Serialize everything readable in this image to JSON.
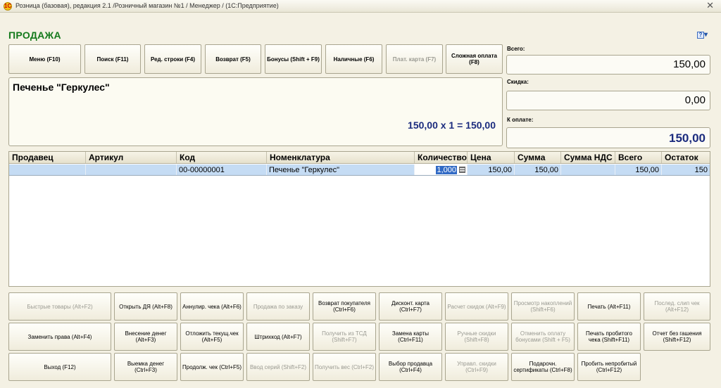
{
  "titlebar": {
    "title": "Розница (базовая), редакция 2.1 /Розничный магазин №1 / Менеджер /  (1С:Предприятие)",
    "app_icon": "1C",
    "close_glyph": "✕"
  },
  "page_title": "ПРОДАЖА",
  "help_glyph": "?",
  "toolbar": [
    {
      "label": "Меню (F10)",
      "disabled": false
    },
    {
      "label": "Поиск (F11)",
      "disabled": false
    },
    {
      "label": "Ред. строки (F4)",
      "disabled": false
    },
    {
      "label": "Возврат (F5)",
      "disabled": false
    },
    {
      "label": "Бонусы (Shift + F9)",
      "disabled": false
    },
    {
      "label": "Наличные (F6)",
      "disabled": false
    },
    {
      "label": "Плат. карта (F7)",
      "disabled": true
    },
    {
      "label": "Сложная оплата (F8)",
      "disabled": false
    }
  ],
  "totals": {
    "total_label": "Всего:",
    "total_value": "150,00",
    "discount_label": "Скидка:",
    "discount_value": "0,00",
    "topay_label": "К оплате:",
    "topay_value": "150,00"
  },
  "product": {
    "name": "Печенье \"Геркулес\"",
    "calc": "150,00  x 1  = 150,00"
  },
  "table": {
    "columns": [
      "Продавец",
      "Артикул",
      "Код",
      "Номенклатура",
      "Количество",
      "Цена",
      "Сумма",
      "Сумма НДС",
      "Всего",
      "Остаток"
    ],
    "rows": [
      {
        "seller": "",
        "article": "",
        "code": "00-00000001",
        "item": "Печенье \"Геркулес\"",
        "qty": "1,000",
        "price": "150,00",
        "sum": "150,00",
        "vat": "",
        "total": "150,00",
        "stock": "150"
      }
    ]
  },
  "bottom": [
    [
      {
        "label": "Быстрые товары (Alt+F2)",
        "disabled": true
      },
      {
        "label": "Открыть ДЯ (Alt+F8)",
        "disabled": false
      },
      {
        "label": "Аннулир. чека (Alt+F6)",
        "disabled": false
      },
      {
        "label": "Продажа по заказу",
        "disabled": true
      },
      {
        "label": "Возврат покупателя (Ctrl+F6)",
        "disabled": false
      },
      {
        "label": "Дисконт. карта (Ctrl+F7)",
        "disabled": false
      },
      {
        "label": "Расчет скидок (Alt+F9)",
        "disabled": true
      },
      {
        "label": "Просмотр накоплений (Shift+F6)",
        "disabled": true
      },
      {
        "label": "Печать (Alt+F11)",
        "disabled": false
      },
      {
        "label": "Послед. слип чек (Alt+F12)",
        "disabled": true
      }
    ],
    [
      {
        "label": "Заменить права (Alt+F4)",
        "disabled": false
      },
      {
        "label": "Внесение денег (Alt+F3)",
        "disabled": false
      },
      {
        "label": "Отложить текущ.чек (Alt+F5)",
        "disabled": false
      },
      {
        "label": "Штрихкод (Alt+F7)",
        "disabled": false
      },
      {
        "label": "Получить из ТСД (Shift+F7)",
        "disabled": true
      },
      {
        "label": "Замена карты (Ctrl+F11)",
        "disabled": false
      },
      {
        "label": "Ручные скидки (Shift+F8)",
        "disabled": true
      },
      {
        "label": "Отменить оплату бонусами (Shift + F5)",
        "disabled": true
      },
      {
        "label": "Печать пробитого чека (Shift+F11)",
        "disabled": false
      },
      {
        "label": "Отчет без гашения (Shift+F12)",
        "disabled": false
      }
    ],
    [
      {
        "label": "Выход (F12)",
        "disabled": false
      },
      {
        "label": "Выемка денег (Ctrl+F3)",
        "disabled": false
      },
      {
        "label": "Продолж. чек (Ctrl+F5)",
        "disabled": false
      },
      {
        "label": "Ввод серий (Shift+F2)",
        "disabled": true
      },
      {
        "label": "Получить вес (Ctrl+F2)",
        "disabled": true
      },
      {
        "label": "Выбор продавца (Ctrl+F4)",
        "disabled": false
      },
      {
        "label": "Управл. скидки (Ctrl+F9)",
        "disabled": true
      },
      {
        "label": "Подарочн. сертификаты (Ctrl+F8)",
        "disabled": false
      },
      {
        "label": "Пробить непробитый (Ctrl+F12)",
        "disabled": false
      }
    ]
  ]
}
